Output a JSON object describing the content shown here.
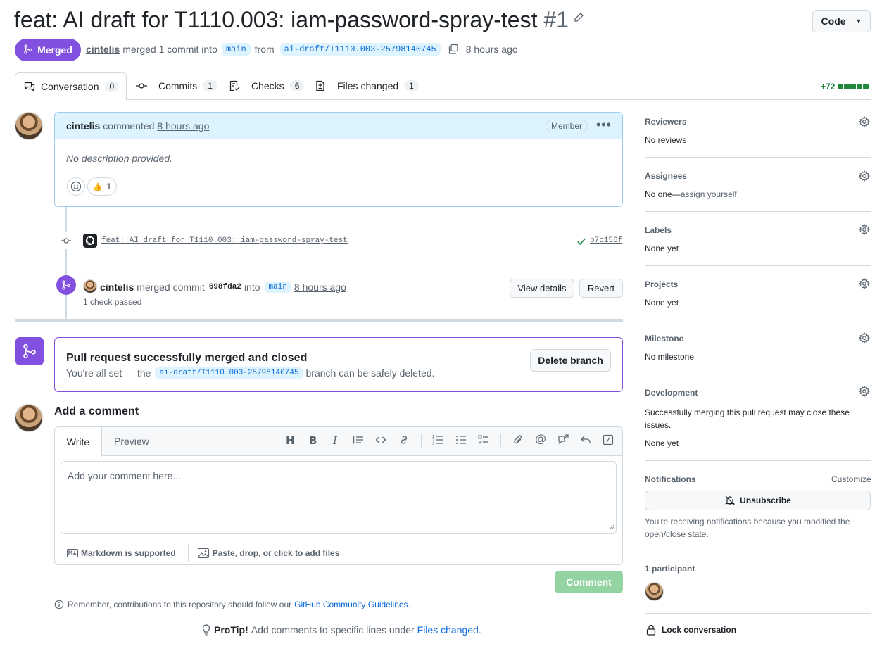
{
  "title": {
    "text": "feat: AI draft for T1110.003: iam-password-spray-test",
    "number": "#1"
  },
  "code_button": "Code",
  "status": {
    "badge": "Merged",
    "author": "cintelis",
    "merged_text": "merged 1 commit into",
    "base_branch": "main",
    "from_text": "from",
    "head_branch": "ai-draft/T1110.003-25798140745",
    "time": "8 hours ago"
  },
  "tabs": [
    {
      "label": "Conversation",
      "count": "0"
    },
    {
      "label": "Commits",
      "count": "1"
    },
    {
      "label": "Checks",
      "count": "6"
    },
    {
      "label": "Files changed",
      "count": "1"
    }
  ],
  "diffstat": "+72",
  "comment": {
    "author": "cintelis",
    "action": "commented",
    "time": "8 hours ago",
    "role": "Member",
    "body": "No description provided.",
    "reaction_emoji": "👍",
    "reaction_count": "1"
  },
  "commit_event": {
    "message": "feat: AI draft for T1110.003: iam-password-spray-test",
    "sha": "b7c156f"
  },
  "merge_event": {
    "author": "cintelis",
    "text1": "merged commit",
    "sha": "698fda2",
    "text2": "into",
    "branch": "main",
    "time": "8 hours ago",
    "checks": "1 check passed",
    "view_details": "View details",
    "revert": "Revert"
  },
  "merged_box": {
    "title": "Pull request successfully merged and closed",
    "desc_pre": "You're all set — the",
    "branch": "ai-draft/T1110.003-25798140745",
    "desc_post": "branch can be safely deleted.",
    "delete_button": "Delete branch"
  },
  "add_comment": {
    "heading": "Add a comment",
    "tab_write": "Write",
    "tab_preview": "Preview",
    "placeholder": "Add your comment here...",
    "markdown": "Markdown is supported",
    "attach": "Paste, drop, or click to add files",
    "submit": "Comment"
  },
  "footer": {
    "reminder_pre": "Remember, contributions to this repository should follow our",
    "reminder_link": "GitHub Community Guidelines",
    "reminder_post": ".",
    "protip_label": "ProTip!",
    "protip_text": "Add comments to specific lines under",
    "protip_link": "Files changed",
    "protip_post": "."
  },
  "sidebar": {
    "reviewers": {
      "title": "Reviewers",
      "value": "No reviews"
    },
    "assignees": {
      "title": "Assignees",
      "value": "No one—",
      "link": "assign yourself"
    },
    "labels": {
      "title": "Labels",
      "value": "None yet"
    },
    "projects": {
      "title": "Projects",
      "value": "None yet"
    },
    "milestone": {
      "title": "Milestone",
      "value": "No milestone"
    },
    "development": {
      "title": "Development",
      "desc": "Successfully merging this pull request may close these issues.",
      "value": "None yet"
    },
    "notifications": {
      "title": "Notifications",
      "customize": "Customize",
      "button": "Unsubscribe",
      "desc": "You're receiving notifications because you modified the open/close state."
    },
    "participants": {
      "title": "1 participant"
    },
    "lock": "Lock conversation"
  },
  "colors": {
    "merged": "#8250df",
    "link": "#0969da",
    "success": "#1a7f37",
    "comment_header": "#ddf4ff"
  }
}
